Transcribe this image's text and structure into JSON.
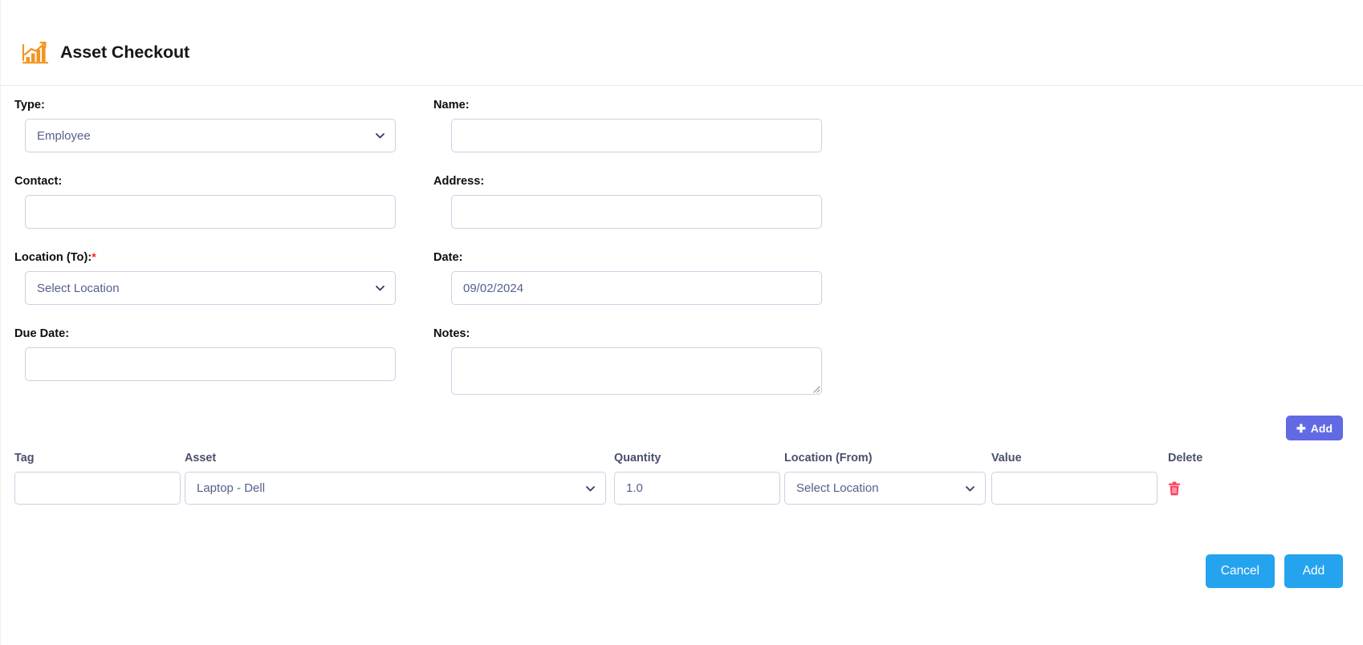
{
  "header": {
    "title": "Asset Checkout",
    "logo_icon": "bar-chart-growth-icon",
    "logo_color": "#f4941f"
  },
  "form": {
    "type": {
      "label": "Type:",
      "value": "Employee",
      "options": [
        "Employee"
      ]
    },
    "name": {
      "label": "Name:",
      "value": "",
      "placeholder": ""
    },
    "contact": {
      "label": "Contact:",
      "value": "",
      "placeholder": ""
    },
    "address": {
      "label": "Address:",
      "value": "",
      "placeholder": ""
    },
    "location_to": {
      "label": "Location (To):",
      "required_marker": "*",
      "value": "Select Location",
      "options": [
        "Select Location"
      ]
    },
    "date": {
      "label": "Date:",
      "value": "09/02/2024"
    },
    "due_date": {
      "label": "Due Date:",
      "value": "",
      "placeholder": ""
    },
    "notes": {
      "label": "Notes:",
      "value": "",
      "placeholder": ""
    }
  },
  "add_line_button": {
    "label": "Add",
    "icon": "plus-icon",
    "color": "#6169e3"
  },
  "items_table": {
    "columns": [
      "Tag",
      "Asset",
      "Quantity",
      "Location (From)",
      "Value",
      "Delete"
    ],
    "rows": [
      {
        "tag": "",
        "asset": "Laptop - Dell",
        "quantity": "1.0",
        "location_from": "Select Location",
        "value": "",
        "delete_icon": "trash-icon"
      }
    ],
    "delete_icon_color": "#fa3e5c"
  },
  "footer": {
    "cancel_label": "Cancel",
    "add_label": "Add",
    "button_color": "#24a3ef"
  }
}
